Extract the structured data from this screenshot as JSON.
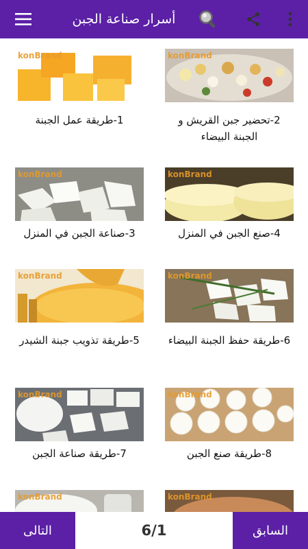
{
  "header": {
    "title": "أسرار صناعة الجبن",
    "icons": [
      "hamburger-icon",
      "search-icon",
      "share-icon",
      "more-vert-icon"
    ]
  },
  "watermark": "konBrand",
  "cards": [
    {
      "caption": "1-طريقة عمل الجبنة"
    },
    {
      "caption": "2-تحضير جبن القريش و الجبنة البيضاء"
    },
    {
      "caption": "3-صناعة الجبن في المنزل"
    },
    {
      "caption": "4-صنع الجبن في المنزل"
    },
    {
      "caption": "5-طريقة تذويب جبنة الشيدر"
    },
    {
      "caption": "6-طريقة حفظ الجبنة البيضاء"
    },
    {
      "caption": "7-طريقة صناعة الجبن"
    },
    {
      "caption": "8-طريقة صنع الجبن"
    },
    {
      "caption": ""
    },
    {
      "caption": ""
    }
  ],
  "footer": {
    "prev_label": "السابق",
    "next_label": "التالى",
    "page_indicator": "6/1"
  },
  "colors": {
    "primary": "#5b20a6"
  }
}
